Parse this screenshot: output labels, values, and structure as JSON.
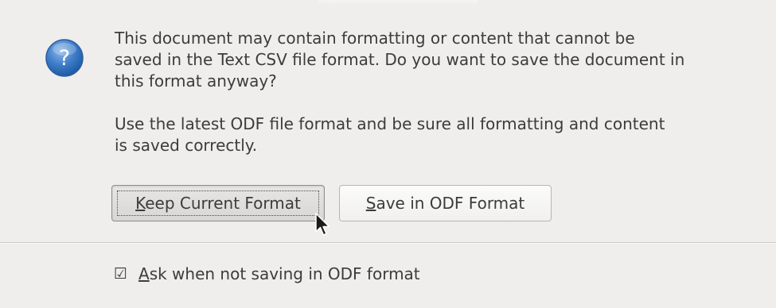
{
  "dialog": {
    "message": {
      "paragraph1": "This document may contain formatting or content that cannot be\nsaved in the Text CSV file format. Do you want to save the document in\nthis format anyway?",
      "paragraph2": "Use the latest ODF file format and be sure all formatting and content\nis saved correctly."
    },
    "buttons": {
      "keep": {
        "mnemonic": "K",
        "rest": "eep Current Format"
      },
      "save": {
        "mnemonic": "S",
        "rest": "ave in ODF Format"
      }
    },
    "checkbox": {
      "checked": true,
      "mark": "☑",
      "mnemonic": "A",
      "rest": "sk when not saving in ODF format"
    },
    "icon": "question-icon",
    "colors": {
      "icon_blue": "#3f7ec9",
      "background": "#efeeed"
    }
  }
}
